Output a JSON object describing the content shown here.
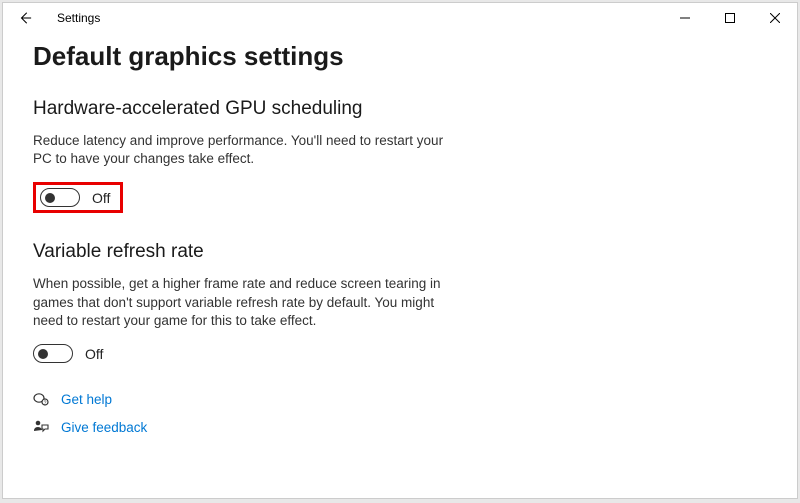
{
  "window": {
    "title": "Settings"
  },
  "page": {
    "title": "Default graphics settings"
  },
  "section1": {
    "heading": "Hardware-accelerated GPU scheduling",
    "description": "Reduce latency and improve performance. You'll need to restart your PC to have your changes take effect.",
    "toggle_state": "Off"
  },
  "section2": {
    "heading": "Variable refresh rate",
    "description": "When possible, get a higher frame rate and reduce screen tearing in games that don't support variable refresh rate by default. You might need to restart your game for this to take effect.",
    "toggle_state": "Off"
  },
  "links": {
    "help": "Get help",
    "feedback": "Give feedback"
  }
}
